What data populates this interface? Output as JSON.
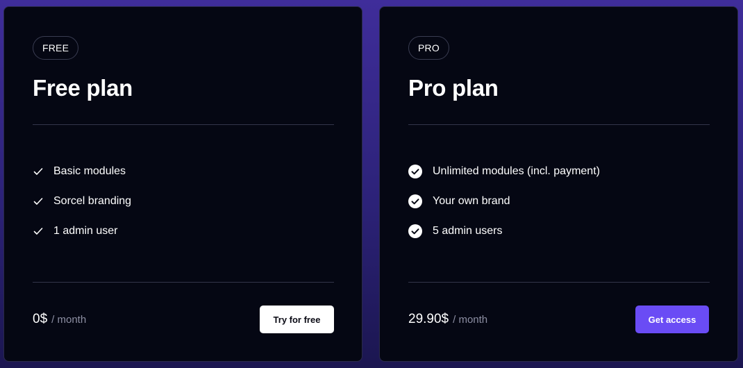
{
  "plans": {
    "free": {
      "badge": "FREE",
      "title": "Free plan",
      "features": [
        {
          "label": "Basic modules",
          "icon": "check-icon"
        },
        {
          "label": "Sorcel branding",
          "icon": "check-icon"
        },
        {
          "label": "1 admin user",
          "icon": "check-icon"
        }
      ],
      "price": "0$",
      "period": "/ month",
      "cta": "Try for free"
    },
    "pro": {
      "badge": "PRO",
      "title": "Pro plan",
      "features": [
        {
          "label": "Unlimited modules (incl. payment)",
          "icon": "check-circle-icon"
        },
        {
          "label": "Your own brand",
          "icon": "check-circle-icon"
        },
        {
          "label": "5 admin users",
          "icon": "check-circle-icon"
        }
      ],
      "price": "29.90$",
      "period": "/ month",
      "cta": "Get access"
    }
  },
  "colors": {
    "background": "#2c2278",
    "card": "#050713",
    "accent": "#6a4cf5",
    "muted": "#8d8fa3"
  }
}
